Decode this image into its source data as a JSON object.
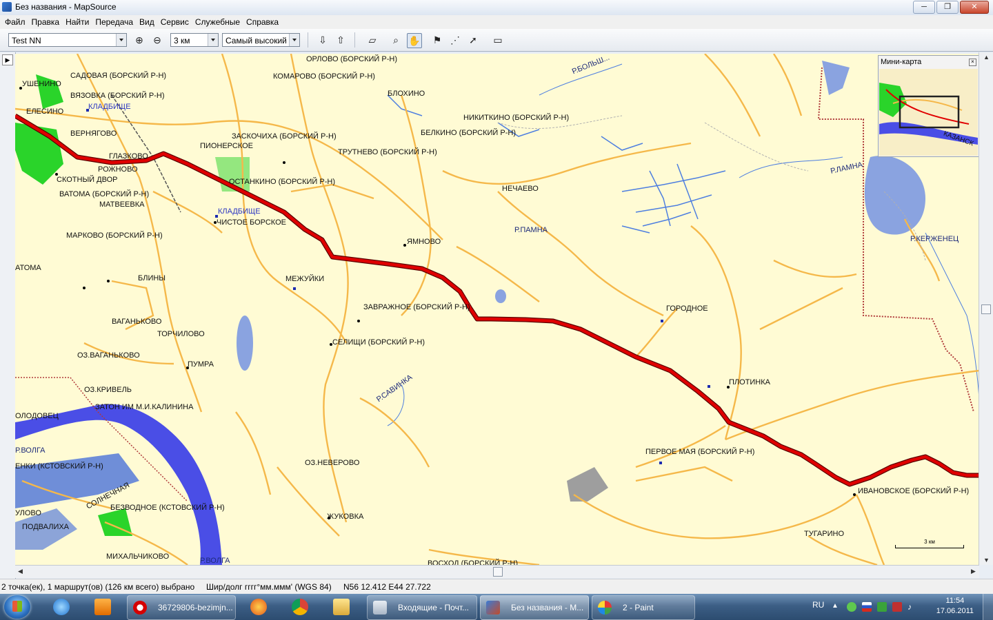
{
  "window": {
    "title": "Без названия - MapSource",
    "controls": {
      "minimize": "─",
      "maximize": "❐",
      "close": "✕"
    }
  },
  "menu": [
    "Файл",
    "Правка",
    "Найти",
    "Передача",
    "Вид",
    "Сервис",
    "Служебные",
    "Справка"
  ],
  "toolbar": {
    "map_product": "Test NN",
    "zoom_scale": "3 км",
    "detail_level": "Самый высокий"
  },
  "map": {
    "places": [
      "УШЕНИНО",
      "САДОВАЯ (БОРСКИЙ Р-Н)",
      "ВЯЗОВКА (БОРСКИЙ Р-Н)",
      "КЛАДБИЩЕ",
      "ЕЛЕСИНО",
      "ВЕРНЯГОВО",
      "ГЛАЗКОВО",
      "РОЖНОВО",
      "СКОТНЫЙ ДВОР",
      "ВАТОМА (БОРСКИЙ Р-Н)",
      "МАТВЕЕВКА",
      "МАРКОВО (БОРСКИЙ Р-Н)",
      "АТОМА",
      "БЛИНЫ",
      "ВАГАНЬКОВО",
      "ТОРЧИЛОВО",
      "ОЗ.ВАГАНЬКОВО",
      "ПУМРА",
      "ОЗ.КРИВЕЛЬ",
      "ЗАТОН ИМ М.И.КАЛИНИНА",
      "ОЛОДОВЕЦ",
      "Р.ВОЛГА",
      "ЕНКИ (КСТОВСКИЙ Р-Н)",
      "СОЛНЕЧНАЯ",
      "БЕЗВОДНОЕ (КСТОВСКИЙ Р-Н)",
      "УЛОВО",
      "ПОДВАЛИХА",
      "МИХАЛЬЧИКОВО",
      "Р.ВОЛГА",
      "ОРЛОВО (БОРСКИЙ Р-Н)",
      "КОМАРОВО (БОРСКИЙ Р-Н)",
      "ЗАСКОЧИХА (БОРСКИЙ Р-Н)",
      "ПИОНЕРСКОЕ",
      "ОСТАНКИНО (БОРСКИЙ Р-Н)",
      "КЛАДБИЩЕ",
      "ЧИСТОЕ БОРСКОЕ",
      "МЕЖУЙКИ",
      "ТРУТНЕВО (БОРСКИЙ Р-Н)",
      "ЯМНОВО",
      "ЗАВРАЖНОЕ (БОРСКИЙ Р-Н)",
      "СЕЛИЩИ (БОРСКИЙ Р-Н)",
      "Р.САВИНКА",
      "ОЗ.НЕВЕРОВО",
      "ЖУКОВКА",
      "ВОСХОД (БОРСКИЙ Р-Н)",
      "БЛОХИНО",
      "НИКИТКИНО (БОРСКИЙ Р-Н)",
      "БЕЛКИНО (БОРСКИЙ Р-Н)",
      "НЕЧАЕВО",
      "Р.ПАМНА",
      "Р.БОЛЬШ...",
      "ГОРОДНОЕ",
      "ПЛОТИНКА",
      "ПЕРВОЕ МАЯ (БОРСКИЙ Р-Н)",
      "ИВАНОВСКОЕ (БОРСКИЙ Р-Н)",
      "ТУГАРИНО",
      "Р.ЛАМНА",
      "Р.КЕРЖЕНЕЦ"
    ],
    "minimap": {
      "title": "Мини-карта",
      "label": "КАЗАНСК"
    },
    "scale_label": "3 км"
  },
  "status": {
    "selection": "2 точка(ек), 1 маршрут(ов) (126 км всего) выбрано",
    "coord_format": "Шир/долг гггг°мм.ммм' (WGS 84)",
    "position": "N56 12.412 E44 27.722"
  },
  "taskbar": {
    "buttons": [
      "36729806-bezimjn...",
      "Входящие - Почт...",
      "Без названия - M...",
      "2 - Paint"
    ],
    "language": "RU",
    "time": "11:54",
    "date": "17.06.2011"
  },
  "colors": {
    "map_bg": "#fffbd4",
    "road": "#f5b84a",
    "route": "#e00000",
    "water": "#6f8ed8",
    "forest": "#2ad42a"
  }
}
